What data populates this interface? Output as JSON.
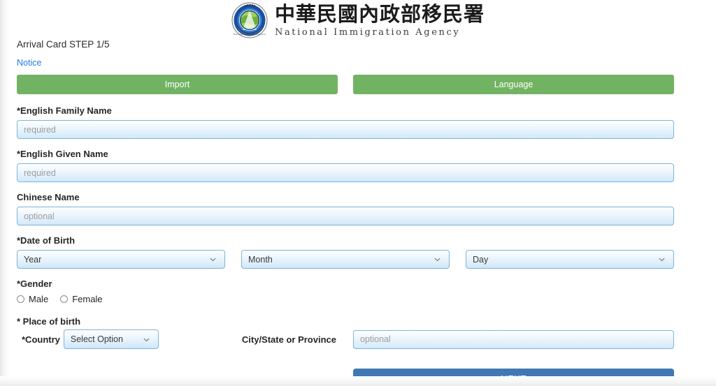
{
  "header": {
    "agency_name_cn": "中華民國內政部移民署",
    "agency_name_en": "National Immigration Agency",
    "emblem_icon": "immigration-agency-emblem-icon"
  },
  "form": {
    "step_title": "Arrival Card STEP 1/5",
    "notice_link": "Notice",
    "import_button": "Import",
    "language_button": "Language",
    "family_name": {
      "label": "*English Family Name",
      "placeholder": "required",
      "value": ""
    },
    "given_name": {
      "label": "*English Given Name",
      "placeholder": "required",
      "value": ""
    },
    "chinese_name": {
      "label": "Chinese Name",
      "placeholder": "optional",
      "value": ""
    },
    "date_of_birth": {
      "label": "*Date of Birth",
      "year_selected": "Year",
      "month_selected": "Month",
      "day_selected": "Day"
    },
    "gender": {
      "label": "*Gender",
      "options": [
        {
          "label": "Male",
          "selected": false
        },
        {
          "label": "Female",
          "selected": false
        }
      ]
    },
    "place_of_birth": {
      "label": "* Place of birth",
      "country_label": "*Country",
      "country_selected": "Select Option",
      "city_label": "City/State or Province",
      "city_placeholder": "optional",
      "city_value": ""
    },
    "next_button": "NEXT"
  },
  "colors": {
    "green_button": "#72b363",
    "blue_button": "#4078b4",
    "link_blue": "#2a7ae2",
    "input_border": "#7db3d8"
  }
}
